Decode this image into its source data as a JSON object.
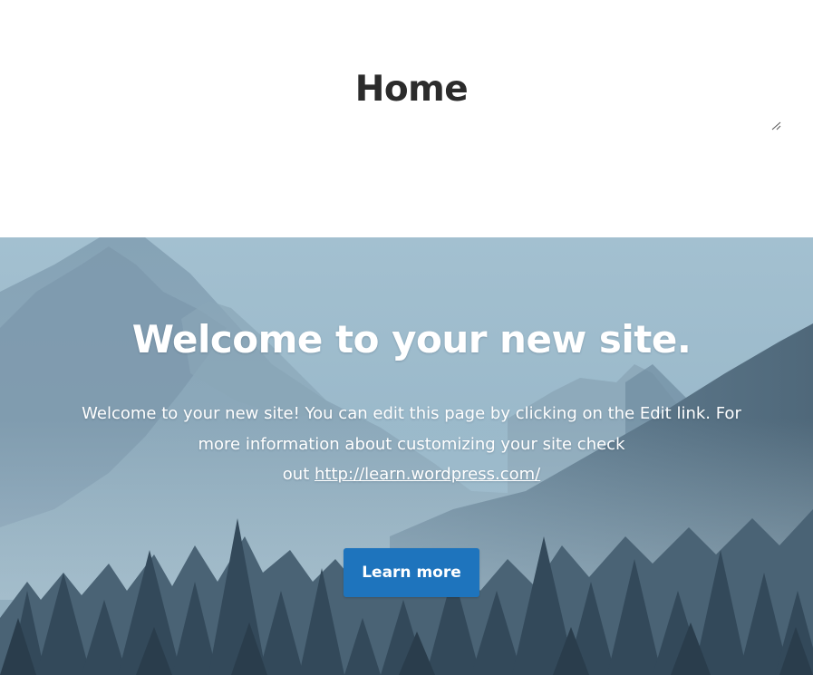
{
  "header": {
    "title": "Home"
  },
  "hero": {
    "heading": "Welcome to your new site.",
    "body_line1": "Welcome to your new site! You can edit this page by clicking on the Edit link. For",
    "body_line2": "more information about customizing your site check",
    "body_line3_prefix": "out ",
    "link_text": "http://learn.wordpress.com/",
    "button_label": "Learn more"
  },
  "colors": {
    "title_text": "#2b2b2b",
    "button_bg": "#1e74bd",
    "sky": "#9ab8c9",
    "mountains": "#7f9cb0",
    "forest": "#3e5668"
  },
  "icons": {
    "resize_handle": "resize-grip-icon"
  }
}
